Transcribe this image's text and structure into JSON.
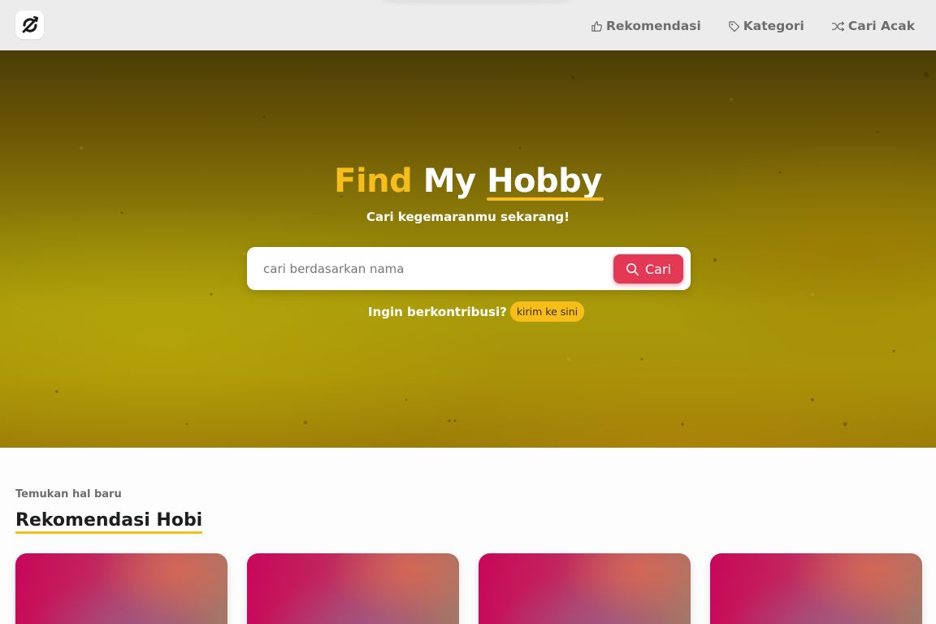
{
  "header": {
    "logo_icon": "broken-circle-logo-icon",
    "nav": [
      {
        "label": "Rekomendasi",
        "icon": "thumbs-up-icon"
      },
      {
        "label": "Kategori",
        "icon": "tag-icon"
      },
      {
        "label": "Cari Acak",
        "icon": "shuffle-icon"
      }
    ]
  },
  "hero": {
    "title_part1": "Find",
    "title_part2": "My",
    "title_part3": "Hobby",
    "subtitle": "Cari kegemaranmu sekarang!",
    "search": {
      "placeholder": "cari berdasarkan nama",
      "value": "",
      "button_label": "Cari",
      "button_icon": "search-icon"
    },
    "contribute_text": "Ingin berkontribusi?",
    "contribute_link": "kirim ke sini"
  },
  "section": {
    "kicker": "Temukan hal baru",
    "title": "Rekomendasi Hobi",
    "cards_count_visible": 4
  },
  "colors": {
    "accent_yellow": "#f7be1a",
    "button_red": "#e33955",
    "header_bg": "#ececec",
    "nav_text": "#6d6d6d"
  }
}
